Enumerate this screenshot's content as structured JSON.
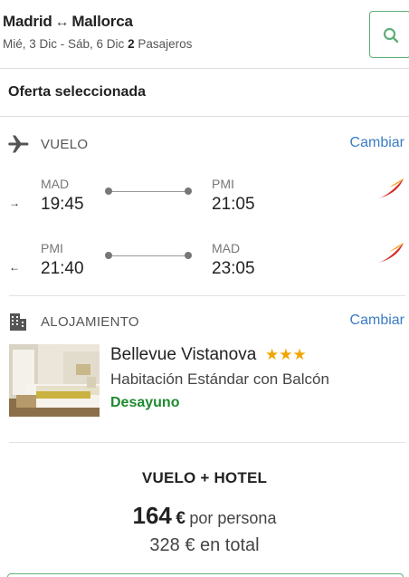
{
  "header": {
    "origin": "Madrid",
    "destination": "Mallorca",
    "dates": "Mié, 3 Dic - Sáb, 6 Dic",
    "passengers_count": "2",
    "passengers_label": "Pasajeros"
  },
  "offer_title": "Oferta seleccionada",
  "flight_section": {
    "label": "VUELO",
    "change_label": "Cambiar",
    "legs": [
      {
        "direction": "outbound",
        "from_code": "MAD",
        "from_time": "19:45",
        "to_code": "PMI",
        "to_time": "21:05"
      },
      {
        "direction": "return",
        "from_code": "PMI",
        "from_time": "21:40",
        "to_code": "MAD",
        "to_time": "23:05"
      }
    ]
  },
  "hotel_section": {
    "label": "ALOJAMIENTO",
    "change_label": "Cambiar",
    "name": "Bellevue Vistanova",
    "stars": "★★★",
    "star_rating": 3,
    "room": "Habitación Estándar con Balcón",
    "board": "Desayuno"
  },
  "summary": {
    "package_label": "VUELO + HOTEL",
    "price_per_person": "164",
    "currency": "€",
    "per_person_label": "por persona",
    "total": "328 € en total"
  },
  "colors": {
    "accent_green": "#5fae79",
    "link_blue": "#3b7dc4",
    "board_green": "#1e8a2e",
    "star_gold": "#f0a500",
    "airline_red": "#d42a2a",
    "airline_orange": "#f5a623"
  },
  "icons": {
    "search": "search-icon",
    "plane": "plane-icon",
    "building": "building-icon",
    "airline": "airline-logo"
  }
}
